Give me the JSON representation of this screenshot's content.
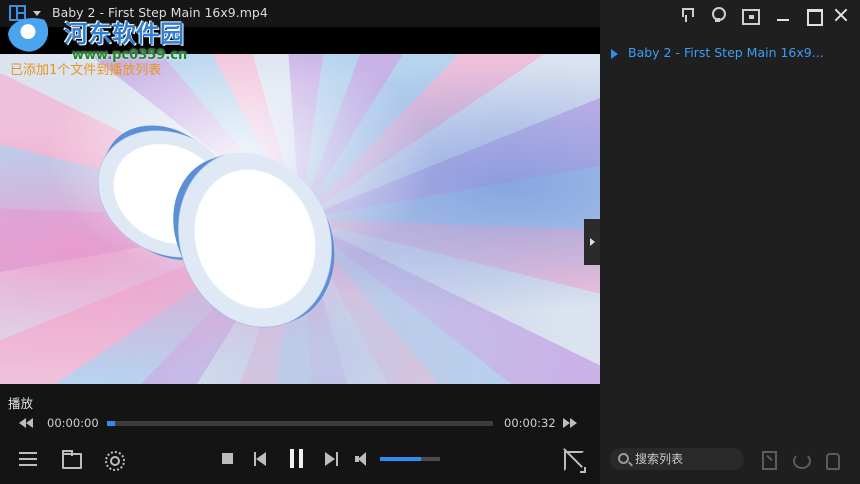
{
  "window": {
    "title": "Baby 2 - First Step Main 16x9.mp4"
  },
  "watermark": {
    "name": "河东软件园",
    "url": "www.pc0359.cn"
  },
  "video": {
    "status_message": "已添加1个文件到播放列表"
  },
  "controls": {
    "state_label": "播放",
    "time_current": "00:00:00",
    "time_total": "00:00:32",
    "seek_fraction": 0.02,
    "volume_fraction": 0.68
  },
  "playlist": {
    "items": [
      {
        "label": "Baby 2 - First Step Main 16x9...",
        "playing": true
      }
    ],
    "search_placeholder": "搜索列表"
  },
  "colors": {
    "accent": "#2d8ef0",
    "status_text": "#e8961f"
  }
}
